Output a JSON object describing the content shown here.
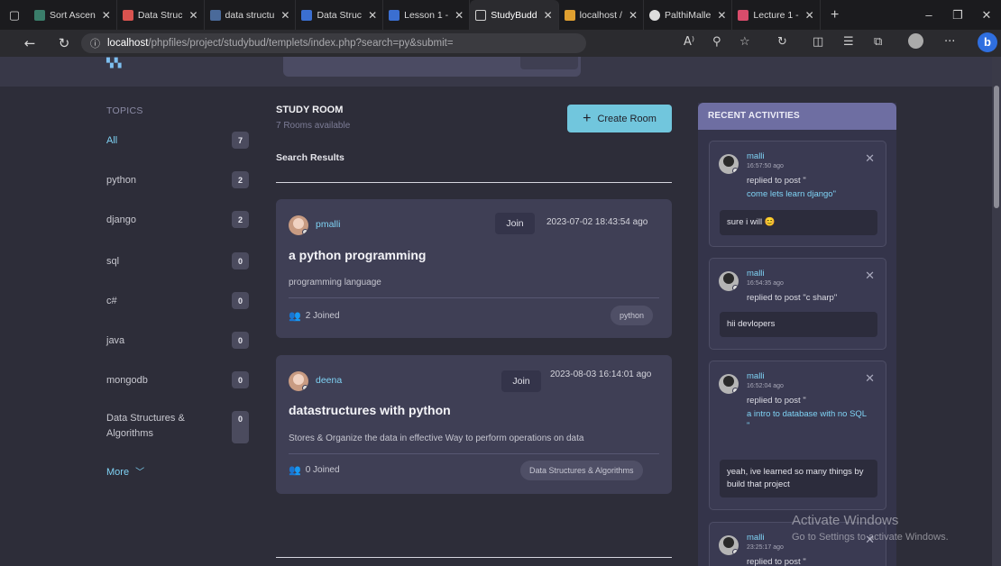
{
  "browser": {
    "tabs": [
      {
        "label": "Sort Ascen",
        "icon": "sort-icon",
        "color": "#3a7d6a"
      },
      {
        "label": "Data Struc",
        "icon": "data-icon",
        "color": "#d9534f"
      },
      {
        "label": "data structu",
        "icon": "search-icon",
        "color": "#4a6a9a"
      },
      {
        "label": "Data Struc",
        "icon": "doc-icon",
        "color": "#3b6fd1"
      },
      {
        "label": "Lesson 1 -",
        "icon": "doc-icon",
        "color": "#3b6fd1"
      },
      {
        "label": "StudyBudd",
        "icon": "page-icon",
        "color": "#cfcfcf"
      },
      {
        "label": "localhost /",
        "icon": "phpmyadmin-icon",
        "color": "#e0a030"
      },
      {
        "label": "PalthiMalle",
        "icon": "github-icon",
        "color": "#dddddd"
      },
      {
        "label": "Lecture 1 -",
        "icon": "lecture-icon",
        "color": "#d94c6b"
      }
    ],
    "url_host": "localhost",
    "url_path": "/phpfiles/project/studybud/templets/index.php?search=py&submit="
  },
  "sidebar": {
    "title": "TOPICS",
    "topics": [
      {
        "name": "All",
        "count": "7"
      },
      {
        "name": "python",
        "count": "2"
      },
      {
        "name": "django",
        "count": "2"
      },
      {
        "name": "sql",
        "count": "0"
      },
      {
        "name": "c#",
        "count": "0"
      },
      {
        "name": "java",
        "count": "0"
      },
      {
        "name": "mongodb",
        "count": "0"
      },
      {
        "name": "Data Structures & Algorithms",
        "count": "0"
      }
    ],
    "more": "More"
  },
  "main": {
    "title": "STUDY ROOM",
    "subtitle": "7 Rooms available",
    "create_button": "Create Room",
    "results_label": "Search Results",
    "rooms": [
      {
        "host": "pmalli",
        "join": "Join",
        "time": "2023-07-02 18:43:54 ago",
        "name": "a python programming",
        "description": "programming language",
        "joined": "2 Joined",
        "topic": "python"
      },
      {
        "host": "deena",
        "join": "Join",
        "time": "2023-08-03 16:14:01 ago",
        "name": "datastructures with python",
        "description": "Stores & Organize the data in effective Way to perform operations on data",
        "joined": "0 Joined",
        "topic": "Data Structures & Algorithms"
      }
    ]
  },
  "activities": {
    "title": "RECENT ACTIVITIES",
    "items": [
      {
        "user": "malli",
        "time": "16:57:50 ago",
        "replied": "replied to post \"",
        "post": "come lets learn django\"",
        "message": "sure i will 😊"
      },
      {
        "user": "malli",
        "time": "16:54:35 ago",
        "replied": "replied to post \"c sharp\"",
        "post": "",
        "message": "hii devlopers"
      },
      {
        "user": "malli",
        "time": "16:52:04 ago",
        "replied": "replied to post \"",
        "post": "a intro to database with no SQL\n\"",
        "message": "yeah, ive learned so many things by build that project"
      },
      {
        "user": "malli",
        "time": "23:25:17 ago",
        "replied": "replied to post \"",
        "post": "",
        "message": ""
      }
    ]
  },
  "watermark": {
    "line1": "Activate Windows",
    "line2": "Go to Settings to activate Windows."
  }
}
